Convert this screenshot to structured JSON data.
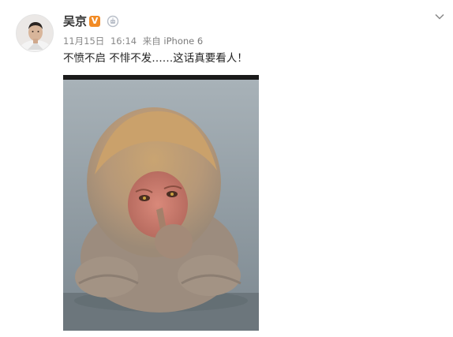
{
  "user": {
    "name": "吴京",
    "verified_label": "V"
  },
  "post": {
    "date": "11月15日",
    "time": "16:14",
    "source_prefix": "来自",
    "device": "iPhone 6",
    "text": "不愤不启 不悱不发……这话真要看人！"
  },
  "icons": {
    "avatar": "avatar-photo",
    "member": "member-robot-icon",
    "menu": "chevron-down-icon",
    "image": "monkey-photo"
  },
  "colors": {
    "verified": "#f28b25",
    "meta_text": "#888888"
  }
}
